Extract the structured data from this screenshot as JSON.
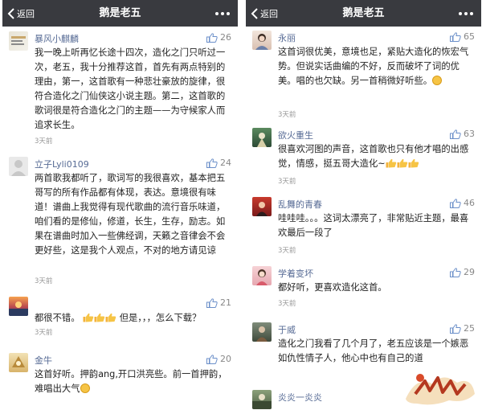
{
  "colors": {
    "nav_bg": "#393a3f",
    "name": "#576b95",
    "meta": "#999999",
    "accent_like": "#6b8fc9"
  },
  "left": {
    "header": {
      "back_label": "返回",
      "title": "鹅是老五"
    },
    "comments": [
      {
        "name": "暴风小麒麟",
        "likes": "26",
        "text": "我一晚上听再忆长途十四次，造化之门只听过一次，老五，我十分推荐这首，首先有两点特别的理由，第一，这首歌有一种悲壮豪放的旋律，很符合造化之门仙侠这小说主题。第二，这首歌的歌词很是符合造化之门的主题——为守候家人而追求长生。",
        "time": "3天前"
      },
      {
        "name": "立子Lyli0109",
        "likes": "24",
        "text": "两首歌我都听了，歌词写的我很喜欢，基本把五哥写的所有作品都有体现，表达。意境很有味道！谱曲上我觉得有现代歌曲的流行音乐味道，咱们看的是修仙，修道，长生，生存，励志。如果在谱曲时加入一些佛经调，天籁之音律会不会更好些，这是我个人观点，不对的地方请见谅",
        "time": "3天前"
      },
      {
        "name": "",
        "likes": "21",
        "text": "都很不错。",
        "text2": "但是，，，怎么下载？",
        "time": "3天前"
      },
      {
        "name": "金牛",
        "likes": "20",
        "text": "这首好听。押韵ang,开口洪亮些。前一首押韵，难唱出大气",
        "time": ""
      }
    ]
  },
  "right": {
    "header": {
      "back_label": "返回",
      "title": "鹅是老五"
    },
    "comments": [
      {
        "name": "永丽",
        "likes": "65",
        "text": "这首词很优美，意境也足，紧贴大造化的恢宏气势。但说实话曲编的不好，反而破坏了词的优美。唱的也欠缺。另一首稍微好听些。",
        "time": "3天前"
      },
      {
        "name": "欲火重生",
        "likes": "63",
        "text": "很喜欢河图的声音，这首歌也只有他才唱的出感觉，情感，挺五哥大造化~",
        "time": "3天前"
      },
      {
        "name": "乱舞的青春",
        "likes": "46",
        "text": "哇哇哇。。。这词太漂亮了，非常贴近主题，最喜欢最后一段了",
        "time": "3天前"
      },
      {
        "name": "学着变坏",
        "likes": "29",
        "text": "都好听，更喜欢造化这首。",
        "time": "3天前"
      },
      {
        "name": "于威",
        "likes": "25",
        "text": "造化之门我看了几个月了，老五应该是一个嫉恶如仇性情子人，他心中也有自己的道",
        "time": ""
      },
      {
        "name": "炎炎一炎炎",
        "likes": "",
        "text": "",
        "time": ""
      }
    ]
  },
  "icons": {
    "back": "chevron-left-icon",
    "more": "more-dots-icon",
    "like": "thumbs-up-icon",
    "emoji": "smile-emoji-icon"
  }
}
